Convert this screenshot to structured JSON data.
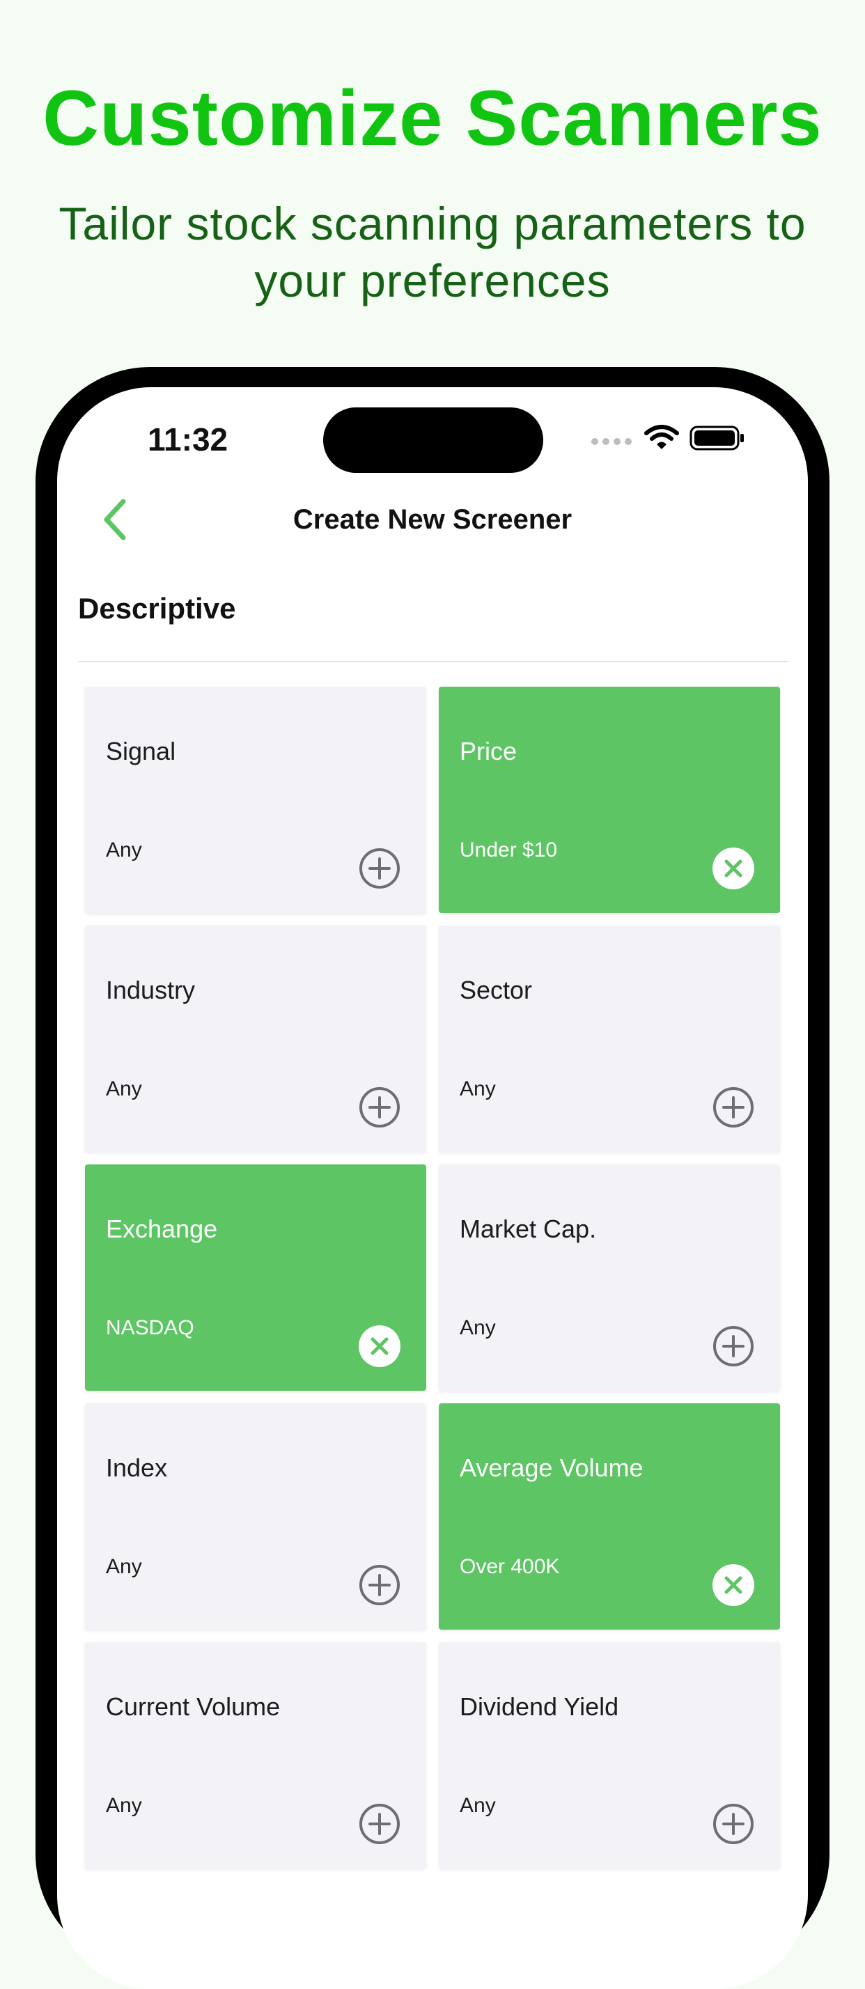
{
  "promo": {
    "title": "Customize Scanners",
    "subtitle": "Tailor stock scanning parameters to your preferences"
  },
  "status_bar": {
    "time": "11:32"
  },
  "nav": {
    "title": "Create New Screener"
  },
  "section": {
    "title": "Descriptive"
  },
  "colors": {
    "accent_green": "#5dc563",
    "promo_title": "#12c412",
    "promo_subtitle": "#166116",
    "card_bg": "#f2f2f7"
  },
  "filters": [
    {
      "label": "Signal",
      "value": "Any",
      "active": false
    },
    {
      "label": "Price",
      "value": "Under $10",
      "active": true
    },
    {
      "label": "Industry",
      "value": "Any",
      "active": false
    },
    {
      "label": "Sector",
      "value": "Any",
      "active": false
    },
    {
      "label": "Exchange",
      "value": "NASDAQ",
      "active": true
    },
    {
      "label": "Market Cap.",
      "value": "Any",
      "active": false
    },
    {
      "label": "Index",
      "value": "Any",
      "active": false
    },
    {
      "label": "Average Volume",
      "value": "Over 400K",
      "active": true
    },
    {
      "label": "Current Volume",
      "value": "Any",
      "active": false
    },
    {
      "label": "Dividend Yield",
      "value": "Any",
      "active": false
    }
  ]
}
